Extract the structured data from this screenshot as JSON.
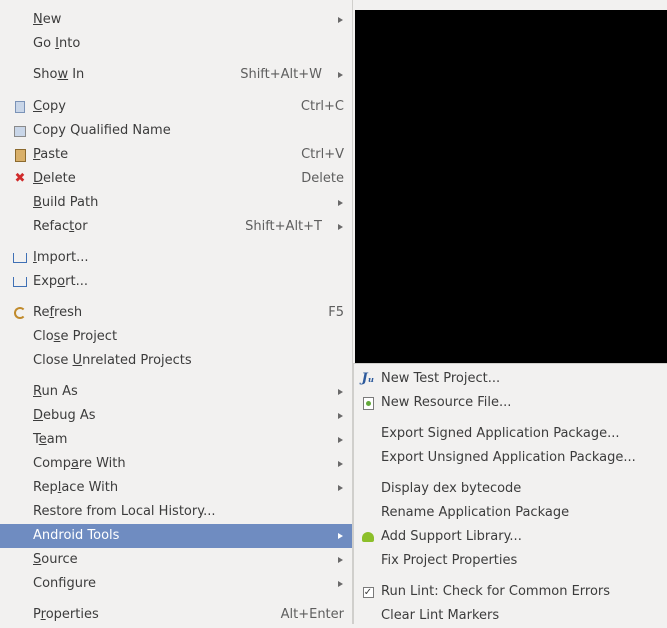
{
  "context_menu": {
    "items": [
      {
        "id": "new",
        "pre": "",
        "ul": "N",
        "post": "ew",
        "shortcut": "",
        "submenu": true,
        "icon": ""
      },
      {
        "id": "go-into",
        "pre": "Go ",
        "ul": "I",
        "post": "nto",
        "shortcut": "",
        "submenu": false,
        "icon": ""
      },
      {
        "id": "show-in",
        "pre": "Sho",
        "ul": "w",
        "post": " In",
        "shortcut": "Shift+Alt+W",
        "submenu": true,
        "icon": ""
      },
      {
        "id": "copy",
        "pre": "",
        "ul": "C",
        "post": "opy",
        "shortcut": "Ctrl+C",
        "submenu": false,
        "icon": "copy-icon"
      },
      {
        "id": "copy-qualified-name",
        "pre": "Copy Qualified Name",
        "ul": "",
        "post": "",
        "shortcut": "",
        "submenu": false,
        "icon": "copy-qualified-name-icon"
      },
      {
        "id": "paste",
        "pre": "",
        "ul": "P",
        "post": "aste",
        "shortcut": "Ctrl+V",
        "submenu": false,
        "icon": "paste-icon"
      },
      {
        "id": "delete",
        "pre": "",
        "ul": "D",
        "post": "elete",
        "shortcut": "Delete",
        "submenu": false,
        "icon": "delete-icon"
      },
      {
        "id": "build-path",
        "pre": "",
        "ul": "B",
        "post": "uild Path",
        "shortcut": "",
        "submenu": true,
        "icon": ""
      },
      {
        "id": "refactor",
        "pre": "Refac",
        "ul": "t",
        "post": "or",
        "shortcut": "Shift+Alt+T",
        "submenu": true,
        "icon": ""
      },
      {
        "id": "import",
        "pre": "",
        "ul": "I",
        "post": "mport...",
        "shortcut": "",
        "submenu": false,
        "icon": "import-icon"
      },
      {
        "id": "export",
        "pre": "Exp",
        "ul": "o",
        "post": "rt...",
        "shortcut": "",
        "submenu": false,
        "icon": "export-icon"
      },
      {
        "id": "refresh",
        "pre": "Re",
        "ul": "f",
        "post": "resh",
        "shortcut": "F5",
        "submenu": false,
        "icon": "refresh-icon"
      },
      {
        "id": "close-project",
        "pre": "Clo",
        "ul": "s",
        "post": "e Project",
        "shortcut": "",
        "submenu": false,
        "icon": ""
      },
      {
        "id": "close-unrelated-projects",
        "pre": "Close ",
        "ul": "U",
        "post": "nrelated Projects",
        "shortcut": "",
        "submenu": false,
        "icon": ""
      },
      {
        "id": "run-as",
        "pre": "",
        "ul": "R",
        "post": "un As",
        "shortcut": "",
        "submenu": true,
        "icon": ""
      },
      {
        "id": "debug-as",
        "pre": "",
        "ul": "D",
        "post": "ebug As",
        "shortcut": "",
        "submenu": true,
        "icon": ""
      },
      {
        "id": "team",
        "pre": "T",
        "ul": "e",
        "post": "am",
        "shortcut": "",
        "submenu": true,
        "icon": ""
      },
      {
        "id": "compare-with",
        "pre": "Comp",
        "ul": "a",
        "post": "re With",
        "shortcut": "",
        "submenu": true,
        "icon": ""
      },
      {
        "id": "replace-with",
        "pre": "Rep",
        "ul": "l",
        "post": "ace With",
        "shortcut": "",
        "submenu": true,
        "icon": ""
      },
      {
        "id": "restore-from-local-history",
        "pre": "Restore from Local History...",
        "ul": "",
        "post": "",
        "shortcut": "",
        "submenu": false,
        "icon": ""
      },
      {
        "id": "android-tools",
        "pre": "Android Tools",
        "ul": "",
        "post": "",
        "shortcut": "",
        "submenu": true,
        "icon": ""
      },
      {
        "id": "source",
        "pre": "",
        "ul": "S",
        "post": "ource",
        "shortcut": "",
        "submenu": true,
        "icon": ""
      },
      {
        "id": "configure",
        "pre": "Configure",
        "ul": "",
        "post": "",
        "shortcut": "",
        "submenu": true,
        "icon": ""
      },
      {
        "id": "properties",
        "pre": "P",
        "ul": "r",
        "post": "operties",
        "shortcut": "Alt+Enter",
        "submenu": false,
        "icon": ""
      }
    ]
  },
  "android_tools_submenu": {
    "items": [
      {
        "id": "new-test-project",
        "label": "New Test Project...",
        "icon": "junit-icon"
      },
      {
        "id": "new-resource-file",
        "label": "New Resource File...",
        "icon": "resource-file-icon"
      },
      {
        "id": "export-signed-application-package",
        "label": "Export Signed Application Package...",
        "icon": ""
      },
      {
        "id": "export-unsigned-application-package",
        "label": "Export Unsigned Application Package...",
        "icon": ""
      },
      {
        "id": "display-dex-bytecode",
        "label": "Display dex bytecode",
        "icon": ""
      },
      {
        "id": "rename-application-package",
        "label": "Rename Application Package",
        "icon": ""
      },
      {
        "id": "add-support-library",
        "label": "Add Support Library...",
        "icon": "android-icon"
      },
      {
        "id": "fix-project-properties",
        "label": "Fix Project Properties",
        "icon": ""
      },
      {
        "id": "run-lint",
        "label": "Run Lint: Check for Common Errors",
        "icon": "checkbox-icon"
      },
      {
        "id": "clear-lint-markers",
        "label": "Clear Lint Markers",
        "icon": ""
      }
    ]
  },
  "icon_glyphs": {
    "delete": "✖",
    "junit": "Jᵤ",
    "check": "✓"
  },
  "colors": {
    "highlight": "#6f8cc1",
    "menu_background": "#f2f1f0",
    "background_window": "#000000"
  }
}
